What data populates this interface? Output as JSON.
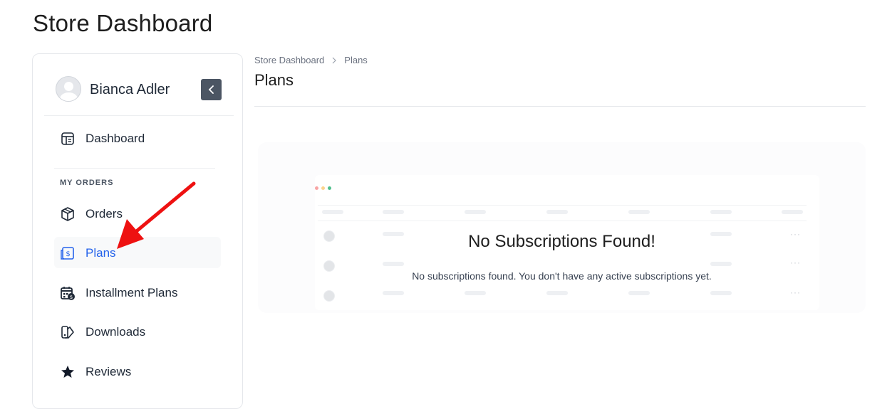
{
  "page": {
    "title": "Store Dashboard"
  },
  "sidebar": {
    "user": {
      "name": "Bianca Adler"
    },
    "collapse_label": "‹",
    "items": [
      {
        "label": "Dashboard",
        "icon": "dashboard-icon"
      },
      {
        "label": "Orders",
        "icon": "box-icon"
      },
      {
        "label": "Plans",
        "icon": "receipt-dollar-icon",
        "active": true
      },
      {
        "label": "Installment Plans",
        "icon": "calendar-dollar-icon"
      },
      {
        "label": "Downloads",
        "icon": "downloads-icon"
      },
      {
        "label": "Reviews",
        "icon": "star-icon"
      }
    ],
    "section_title": "MY ORDERS"
  },
  "breadcrumb": {
    "root": "Store Dashboard",
    "current": "Plans"
  },
  "main": {
    "title": "Plans",
    "empty": {
      "title": "No Subscriptions Found!",
      "description": "No subscriptions found. You don't have any active subscriptions yet.",
      "row_menu": "···"
    }
  },
  "colors": {
    "accent": "#2563eb",
    "annotation_arrow": "#ee1111"
  }
}
